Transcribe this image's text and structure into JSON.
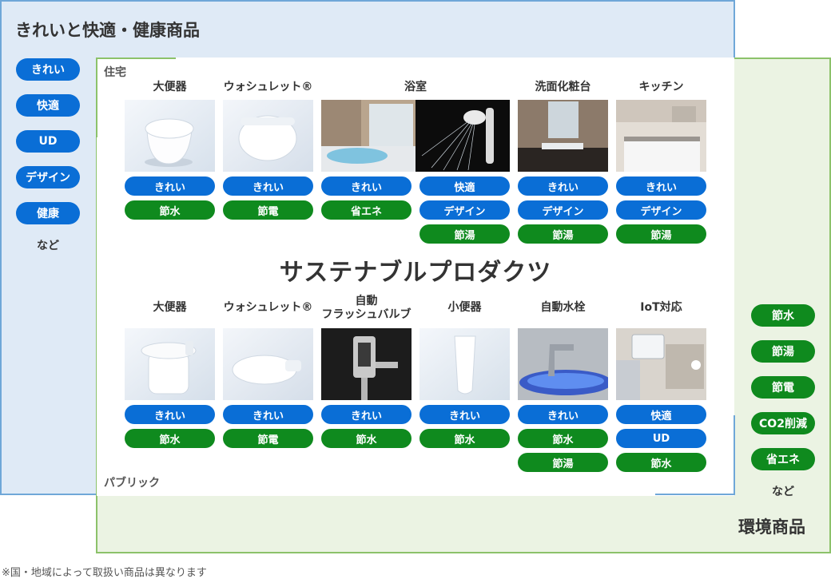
{
  "comfort": {
    "title": "きれいと快適・健康商品",
    "pills": [
      "きれい",
      "快適",
      "UD",
      "デザイン",
      "健康"
    ],
    "etc": "など"
  },
  "eco": {
    "title": "環境商品",
    "pills": [
      "節水",
      "節湯",
      "節電",
      "CO2削減",
      "省エネ"
    ],
    "etc": "など"
  },
  "center_title": "サステナブルプロダクツ",
  "residential": {
    "label": "住宅",
    "columns": [
      {
        "title": "大便器",
        "blue": [
          "きれい"
        ],
        "green": [
          "節水"
        ]
      },
      {
        "title": "ウォシュレット®",
        "blue": [
          "きれい"
        ],
        "green": [
          "節電"
        ]
      },
      {
        "title": "浴室",
        "blue": [
          "きれい",
          "快適",
          "デザイン"
        ],
        "green": [
          "省エネ",
          "節湯"
        ]
      },
      {
        "title": "洗面化粧台",
        "blue": [
          "きれい",
          "デザイン"
        ],
        "green": [
          "節湯"
        ]
      },
      {
        "title": "キッチン",
        "blue": [
          "きれい",
          "デザイン"
        ],
        "green": [
          "節湯"
        ]
      }
    ]
  },
  "public": {
    "label": "パブリック",
    "columns": [
      {
        "title": "大便器",
        "blue": [
          "きれい"
        ],
        "green": [
          "節水"
        ]
      },
      {
        "title": "ウォシュレット®",
        "blue": [
          "きれい"
        ],
        "green": [
          "節電"
        ]
      },
      {
        "title_line1": "自動",
        "title_line2": "フラッシュバルブ",
        "blue": [
          "きれい"
        ],
        "green": [
          "節水"
        ]
      },
      {
        "title": "小便器",
        "blue": [
          "きれい"
        ],
        "green": [
          "節水"
        ]
      },
      {
        "title": "自動水栓",
        "blue": [
          "きれい"
        ],
        "green": [
          "節水",
          "節湯"
        ]
      },
      {
        "title": "IoT対応",
        "blue": [
          "快適",
          "UD"
        ],
        "green": [
          "節水"
        ]
      }
    ]
  },
  "footnote": "※国・地域によって取扱い商品は異なります"
}
